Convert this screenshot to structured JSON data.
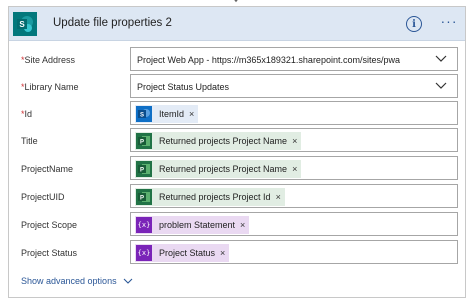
{
  "header": {
    "title": "Update file properties 2",
    "info_icon": "info-icon",
    "info_glyph": "i",
    "more_icon": "more-options-icon",
    "more_glyph": "···",
    "logo_icon": "sharepoint-logo-icon",
    "logo_letter": "S"
  },
  "fields": {
    "site_address": {
      "label": "Site Address",
      "required": "*",
      "value": "Project Web App - https://m365x189321.sharepoint.com/sites/pwa"
    },
    "library_name": {
      "label": "Library Name",
      "required": "*",
      "value": "Project Status Updates"
    },
    "id": {
      "label": "Id",
      "required": "*",
      "token": "ItemId",
      "token_icon": "sharepoint-token-icon"
    },
    "title": {
      "label": "Title",
      "token": "Returned projects Project Name",
      "token_icon": "project-token-icon"
    },
    "project_name": {
      "label": "ProjectName",
      "token": "Returned projects Project Name",
      "token_icon": "project-token-icon"
    },
    "project_uid": {
      "label": "ProjectUID",
      "token": "Returned projects Project Id",
      "token_icon": "project-token-icon"
    },
    "project_scope": {
      "label": "Project Scope",
      "token": "problem Statement",
      "token_icon": "variable-token-icon"
    },
    "project_status": {
      "label": "Project Status",
      "token": "Project Status",
      "token_icon": "variable-token-icon"
    }
  },
  "token_remove": "×",
  "variable_glyph": "{x}",
  "show_advanced": "Show advanced options",
  "colors": {
    "header_bg": "#dde7f3",
    "accent": "#2b5797",
    "required": "#d13438",
    "sharepoint": "#03787c",
    "project_green": "#217346",
    "variable_purple": "#7a24b8"
  }
}
